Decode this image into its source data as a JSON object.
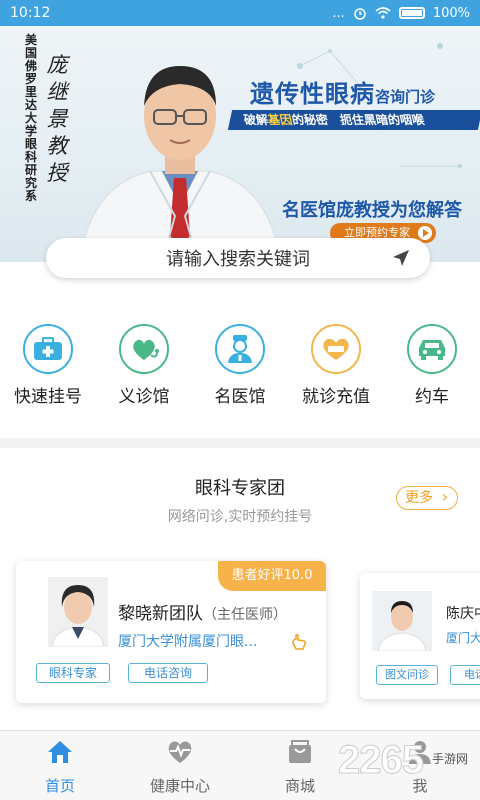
{
  "status_bar": {
    "time": "10:12",
    "dots": "...",
    "battery": "100%"
  },
  "banner": {
    "vertical_text": "美国佛罗里达大学眼科研究系",
    "doctor_name": "庞继景教授",
    "title": "遗传性眼病",
    "title_suffix": "咨询门诊",
    "strip_text_1": "破解",
    "strip_highlight": "基因",
    "strip_text_2": "的秘密　扼住黑暗的咽喉",
    "subtitle": "名医馆庞教授为您解答",
    "cta_label": "立即预约专家"
  },
  "search": {
    "placeholder": "请输入搜索关键词"
  },
  "quick_menu": [
    {
      "label": "快速挂号",
      "icon": "medical-kit-icon",
      "color": "#3ab0e0"
    },
    {
      "label": "义诊馆",
      "icon": "stethoscope-heart-icon",
      "color": "#49b889"
    },
    {
      "label": "名医馆",
      "icon": "doctor-icon",
      "color": "#3ab0e0"
    },
    {
      "label": "就诊充值",
      "icon": "heart-card-icon",
      "color": "#f2b64a"
    },
    {
      "label": "约车",
      "icon": "car-icon",
      "color": "#49b889"
    }
  ],
  "section": {
    "title": "眼科专家团",
    "subtitle": "网络问诊,实时预约挂号",
    "more_label": "更多"
  },
  "cards": [
    {
      "badge": "患者好评10.0",
      "name": "黎晓新团队",
      "title": "（主任医师）",
      "hospital": "厦门大学附属厦门眼...",
      "tags": [
        "眼科专家",
        "电话咨询"
      ]
    },
    {
      "name": "陈庆中",
      "hospital": "厦门大",
      "tags": [
        "图文问诊",
        "电话"
      ]
    }
  ],
  "bottom_nav": [
    {
      "label": "首页",
      "icon": "home-icon",
      "active": true
    },
    {
      "label": "健康中心",
      "icon": "heart-pulse-icon",
      "active": false
    },
    {
      "label": "商城",
      "icon": "shop-icon",
      "active": false
    },
    {
      "label": "我",
      "icon": "user-icon",
      "active": false
    }
  ],
  "watermark": {
    "number": "2265",
    "suffix": "手游网"
  },
  "colors": {
    "primary": "#3fa3e0",
    "accent": "#f0a020",
    "link": "#3a8fd6"
  }
}
